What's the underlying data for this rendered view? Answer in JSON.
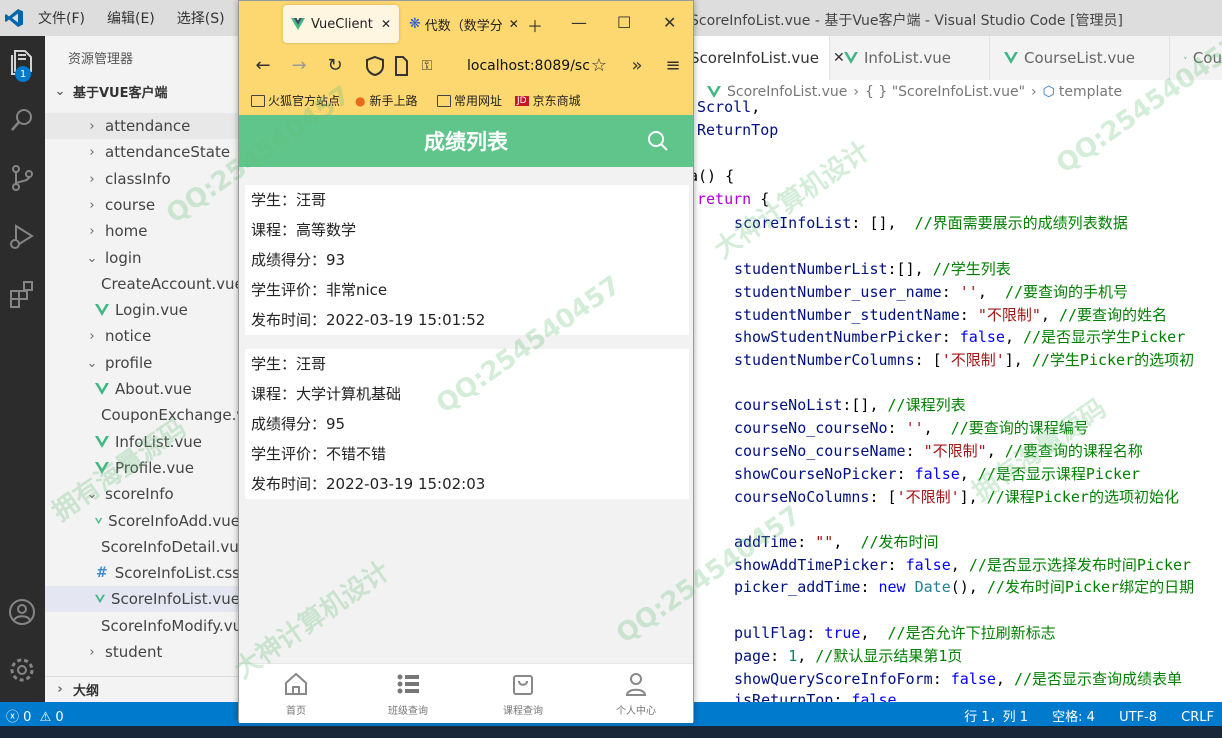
{
  "vscode": {
    "menu": [
      "文件(F)",
      "编辑(E)",
      "选择(S)"
    ],
    "window_title": "ScoreInfoList.vue - 基于Vue客户端 - Visual Studio Code [管理员]",
    "explorer_title": "资源管理器",
    "root_folder": "基于VUE客户端",
    "explorer_badge": "1",
    "tree": [
      {
        "label": "attendance",
        "type": "folder"
      },
      {
        "label": "attendanceState",
        "type": "folder"
      },
      {
        "label": "classInfo",
        "type": "folder"
      },
      {
        "label": "course",
        "type": "folder"
      },
      {
        "label": "home",
        "type": "folder"
      },
      {
        "label": "login",
        "type": "folder-open"
      },
      {
        "label": "CreateAccount.vue",
        "type": "vue"
      },
      {
        "label": "Login.vue",
        "type": "vue"
      },
      {
        "label": "notice",
        "type": "folder"
      },
      {
        "label": "profile",
        "type": "folder-open"
      },
      {
        "label": "About.vue",
        "type": "vue"
      },
      {
        "label": "CouponExchange.vue",
        "type": "vue"
      },
      {
        "label": "InfoList.vue",
        "type": "vue"
      },
      {
        "label": "Profile.vue",
        "type": "vue"
      },
      {
        "label": "scoreInfo",
        "type": "folder-open"
      },
      {
        "label": "ScoreInfoAdd.vue",
        "type": "vue"
      },
      {
        "label": "ScoreInfoDetail.vue",
        "type": "vue"
      },
      {
        "label": "ScoreInfoList.css",
        "type": "css"
      },
      {
        "label": "ScoreInfoList.vue",
        "type": "vue"
      },
      {
        "label": "ScoreInfoModify.vue",
        "type": "vue"
      },
      {
        "label": "student",
        "type": "folder"
      }
    ],
    "outline": "大纲",
    "tabs": [
      "ScoreInfoList.vue",
      "InfoList.vue",
      "CourseList.vue",
      "Cou"
    ],
    "breadcrumb": [
      "ScoreInfoList.vue",
      "{ } \"ScoreInfoList.vue\"",
      "template"
    ],
    "status": {
      "errors": "0",
      "warnings": "0",
      "position": "行 1，列 1",
      "spaces": "空格: 4",
      "encoding": "UTF-8",
      "eol": "CRLF"
    }
  },
  "browser": {
    "tabs": [
      "VueClient",
      "代数（数学分"
    ],
    "url": "localhost:8089/sc",
    "bookmarks": [
      "火狐官方站点",
      "新手上路",
      "常用网址",
      "京东商城"
    ]
  },
  "app": {
    "title": "成绩列表",
    "records": [
      {
        "student": "学生：汪哥",
        "course": "课程：高等数学",
        "score": "成绩得分：93",
        "eval": "学生评价：非常nice",
        "time": "发布时间：2022-03-19 15:01:52"
      },
      {
        "student": "学生：汪哥",
        "course": "课程：大学计算机基础",
        "score": "成绩得分：95",
        "eval": "学生评价：不错不错",
        "time": "发布时间：2022-03-19 15:02:03"
      }
    ],
    "tabbar": [
      "首页",
      "班级查询",
      "课程查询",
      "个人中心"
    ]
  },
  "watermarks": [
    "QQ:254540457",
    "大神计算机设计",
    "拥有海量源码"
  ],
  "colors": {
    "app_header": "#5fc58b",
    "vscode_status": "#007acc",
    "browser_chrome": "#fdd870"
  }
}
